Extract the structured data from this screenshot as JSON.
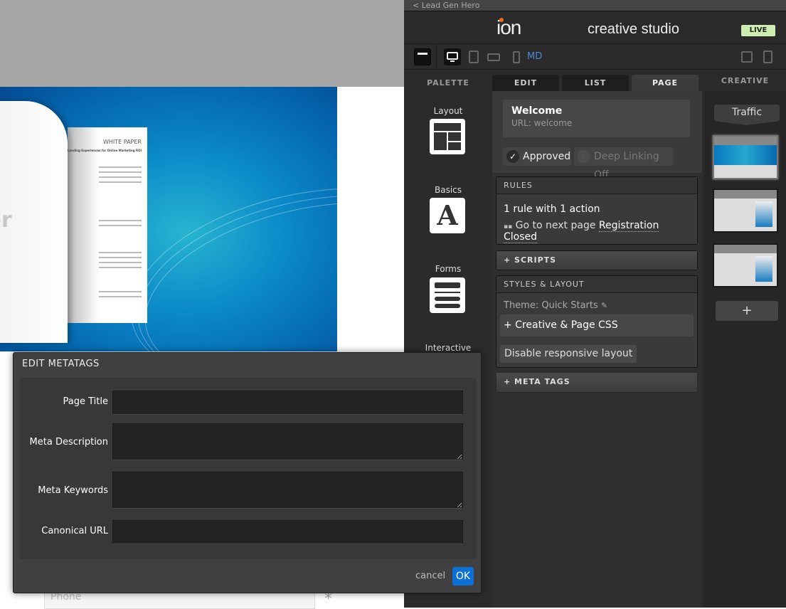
{
  "canvas": {
    "hero_image": {
      "lettering": [
        "WHITE PAPER",
        "Managing Landing Experiences for Online Marketing ROI",
        "per"
      ]
    },
    "phone_placeholder": "Phone",
    "required_mark": "*"
  },
  "studio": {
    "back_link": "< Lead Gen Hero",
    "logo": "ion",
    "title": "creative studio",
    "status_badge": "LIVE",
    "toolbar": {
      "icons": [
        "layout-toggle-icon",
        "desktop-icon",
        "tablet-icon",
        "tablet-landscape-icon",
        "phone-icon",
        "preview-icon",
        "document-icon"
      ],
      "breakpoint": "MD",
      "accent": "#4a8ad4"
    },
    "tabs": [
      {
        "label": "PALETTE"
      },
      {
        "label": "EDIT"
      },
      {
        "label": "LIST"
      },
      {
        "label": "PAGE",
        "active": true
      },
      {
        "label": "CREATIVE"
      }
    ],
    "palette": [
      {
        "label": "Layout",
        "icon": "layout-icon"
      },
      {
        "label": "Basics",
        "icon": "text-icon"
      },
      {
        "label": "Forms",
        "icon": "form-icon"
      },
      {
        "label": "Interactive"
      }
    ],
    "page": {
      "name": "Welcome",
      "url": "URL: welcome",
      "approved": {
        "label": "Approved",
        "checked": true
      },
      "deep_linking": {
        "label": "Deep Linking Off",
        "checked": false
      },
      "rules": {
        "header": "RULES",
        "summary": "1 rule with 1 action",
        "action_prefix": "Go to next page",
        "action_target": "Registration Closed"
      },
      "scripts": "+ SCRIPTS",
      "styles": {
        "header": "STYLES & LAYOUT",
        "theme": "Theme: Quick Starts",
        "css": "+ Creative & Page CSS",
        "responsive": "Disable responsive layout"
      },
      "meta_tags": "+ META TAGS"
    },
    "creative": {
      "traffic": "Traffic",
      "thumb_count": 3,
      "add": "+"
    }
  },
  "modal": {
    "title": "EDIT METATAGS",
    "fields": [
      {
        "label": "Page Title",
        "value": ""
      },
      {
        "label": "Meta Description",
        "value": ""
      },
      {
        "label": "Meta Keywords",
        "value": ""
      },
      {
        "label": "Canonical URL",
        "value": ""
      }
    ],
    "cancel": "cancel",
    "ok": "OK",
    "ok_color": "#0b6fd6"
  }
}
